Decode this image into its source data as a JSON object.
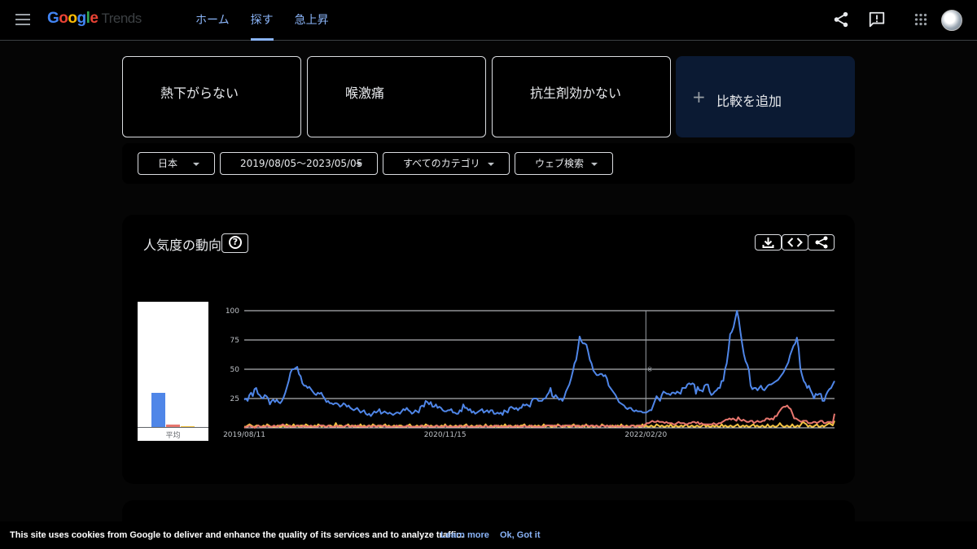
{
  "header": {
    "logo": {
      "g1": "G",
      "g2": "o",
      "g3": "o",
      "g4": "g",
      "g5": "l",
      "g6": "e",
      "product": "Trends"
    },
    "nav": [
      "ホーム",
      "探す",
      "急上昇"
    ],
    "active_nav": "探す",
    "icons": [
      "menu-icon",
      "share-icon",
      "feedback-icon",
      "apps-icon",
      "avatar"
    ]
  },
  "terms": [
    {
      "label": "熱下がらない",
      "color": "#4285f4"
    },
    {
      "label": "喉激痛",
      "color": "#ea4335"
    },
    {
      "label": "抗生剤効かない",
      "color": "#fbbc04"
    }
  ],
  "add_compare": {
    "icon": "+",
    "label": "比較を追加"
  },
  "filters": {
    "region": "日本",
    "date_range": "2019/08/05～2023/05/05",
    "category": "すべてのカテゴリ",
    "search_type": "ウェブ検索"
  },
  "interest_panel": {
    "title": "人気度の動向",
    "help_icon": "?",
    "tools": [
      "download-icon",
      "embed-icon",
      "share-icon"
    ],
    "average_label": "平均",
    "annotation_mark": "※"
  },
  "chart_data": {
    "type": "line",
    "x_tick_labels": [
      "2019/08/11",
      "2020/11/15",
      "2022/02/20"
    ],
    "y_ticks": [
      25,
      50,
      75,
      100
    ],
    "ylim": [
      0,
      100
    ],
    "grid": true,
    "x_start": "2019/08/11",
    "x_end": "2023/04/30",
    "annotation_x": "2022/02/20",
    "averages": [
      {
        "name": "熱下がらない",
        "value": 29
      },
      {
        "name": "喉激痛",
        "value": 2
      },
      {
        "name": "抗生剤効かない",
        "value": 1
      }
    ],
    "series": [
      {
        "name": "熱下がらない",
        "color": "#4f86e8",
        "values": [
          24,
          25,
          23,
          28,
          30,
          27,
          33,
          34,
          29,
          28,
          26,
          25,
          28,
          27,
          25,
          20,
          23,
          24,
          22,
          24,
          22,
          21,
          23,
          26,
          30,
          35,
          40,
          47,
          50,
          50,
          51,
          52,
          46,
          44,
          38,
          36,
          36,
          34,
          35,
          33,
          31,
          29,
          28,
          30,
          29,
          30,
          27,
          25,
          22,
          23,
          21,
          21,
          20,
          21,
          21,
          20,
          18,
          19,
          21,
          20,
          18,
          19,
          17,
          16,
          15,
          16,
          17,
          15,
          13,
          14,
          15,
          12,
          11,
          12,
          10,
          12,
          14,
          13,
          14,
          16,
          12,
          13,
          14,
          13,
          12,
          13,
          12,
          11,
          12,
          13,
          13,
          12,
          14,
          16,
          15,
          17,
          15,
          14,
          12,
          13,
          15,
          14,
          13,
          18,
          19,
          18,
          23,
          22,
          20,
          22,
          18,
          18,
          20,
          17,
          18,
          17,
          15,
          14,
          14,
          15,
          15,
          16,
          13,
          13,
          12,
          12,
          15,
          14,
          20,
          17,
          17,
          15,
          16,
          13,
          14,
          12,
          13,
          14,
          15,
          16,
          13,
          14,
          15,
          13,
          15,
          15,
          12,
          12,
          13,
          12,
          13,
          11,
          15,
          14,
          13,
          17,
          18,
          17,
          16,
          17,
          15,
          17,
          17,
          20,
          19,
          20,
          19,
          18,
          23,
          25,
          25,
          25,
          23,
          23,
          23,
          25,
          25,
          28,
          30,
          34,
          27,
          26,
          28,
          26,
          24,
          25,
          23,
          26,
          31,
          34,
          37,
          42,
          48,
          55,
          58,
          67,
          78,
          74,
          72,
          72,
          71,
          65,
          58,
          55,
          49,
          47,
          45,
          45,
          46,
          46,
          44,
          45,
          42,
          36,
          34,
          32,
          30,
          28,
          25,
          22,
          21,
          20,
          19,
          17,
          16,
          17,
          17,
          15,
          14,
          15,
          14,
          14,
          14,
          13,
          13,
          13,
          14,
          15,
          15,
          19,
          23,
          27,
          25,
          23,
          28,
          31,
          30,
          29,
          29,
          28,
          30,
          30,
          29,
          31,
          30,
          29,
          34,
          34,
          34,
          37,
          38,
          37,
          38,
          37,
          29,
          35,
          32,
          32,
          31,
          36,
          37,
          37,
          31,
          28,
          29,
          31,
          32,
          34,
          34,
          40,
          40,
          50,
          55,
          66,
          80,
          82,
          86,
          93,
          100,
          93,
          82,
          72,
          63,
          57,
          54,
          49,
          36,
          33,
          34,
          34,
          32,
          34,
          36,
          33,
          32,
          34,
          36,
          37,
          37,
          38,
          39,
          40,
          41,
          43,
          45,
          47,
          50,
          53,
          56,
          62,
          66,
          70,
          72,
          77,
          68,
          51,
          45,
          40,
          38,
          34,
          36,
          32,
          29,
          25,
          29,
          28,
          29,
          29,
          23,
          23,
          28,
          31,
          33,
          34,
          37,
          40
        ]
      },
      {
        "name": "喉激痛",
        "color": "#e8776f",
        "values": [
          0,
          1,
          1,
          2,
          1,
          1,
          0,
          1,
          2,
          1,
          1,
          1,
          1,
          2,
          1,
          1,
          1,
          2,
          1,
          1,
          2,
          2,
          3,
          2,
          1,
          1,
          2,
          1,
          1,
          1,
          2,
          2,
          1,
          1,
          2,
          1,
          1,
          1,
          2,
          1,
          1,
          1,
          1,
          2,
          2,
          2,
          1,
          1,
          2,
          1,
          1,
          1,
          1,
          2,
          1,
          1,
          1,
          1,
          2,
          2,
          1,
          1,
          2,
          1,
          1,
          2,
          1,
          1,
          1,
          1,
          1,
          2,
          1,
          1,
          2,
          1,
          1,
          2,
          2,
          1,
          2,
          1,
          1,
          1,
          1,
          1,
          1,
          2,
          1,
          1,
          1,
          1,
          1,
          2,
          1,
          1,
          1,
          1,
          1,
          1,
          1,
          2,
          1,
          1,
          1,
          2,
          1,
          1,
          1,
          1,
          2,
          1,
          1,
          1,
          1,
          2,
          1,
          1,
          1,
          1,
          1,
          1,
          1,
          2,
          1,
          1,
          1,
          2,
          1,
          1,
          1,
          1,
          1,
          1,
          2,
          1,
          1,
          1,
          2,
          1,
          1,
          1,
          1,
          2,
          1,
          2,
          1,
          1,
          1,
          1,
          1,
          2,
          1,
          1,
          1,
          1,
          2,
          1,
          1,
          1,
          2,
          1,
          1,
          1,
          2,
          1,
          1,
          1,
          1,
          1,
          1,
          1,
          2,
          2,
          2,
          2,
          2,
          1,
          2,
          2,
          2,
          1,
          2,
          1,
          2,
          2,
          2,
          1,
          2,
          2,
          1,
          2,
          1,
          1,
          2,
          2,
          2,
          1,
          2,
          2,
          1,
          2,
          1,
          1,
          2,
          2,
          1,
          2,
          1,
          2,
          1,
          1,
          2,
          1,
          1,
          1,
          2,
          1,
          1,
          1,
          1,
          2,
          2,
          1,
          1,
          2,
          2,
          1,
          2,
          3,
          4,
          4,
          5,
          6,
          5,
          5,
          6,
          5,
          5,
          5,
          4,
          5,
          4,
          4,
          4,
          3,
          3,
          4,
          5,
          4,
          4,
          4,
          3,
          3,
          4,
          4,
          5,
          5,
          4,
          5,
          3,
          4,
          3,
          3,
          3,
          3,
          3,
          3,
          4,
          3,
          3,
          4,
          4,
          5,
          6,
          7,
          7,
          8,
          7,
          8,
          7,
          6,
          9,
          7,
          6,
          7,
          6,
          5,
          5,
          6,
          6,
          4,
          5,
          6,
          5,
          5,
          6,
          6,
          8,
          8,
          7,
          8,
          7,
          10,
          10,
          13,
          15,
          17,
          18,
          18,
          19,
          17,
          16,
          12,
          8,
          8,
          7,
          6,
          5,
          6,
          6,
          6,
          4,
          4,
          4,
          5,
          5,
          4,
          5,
          6,
          6,
          4,
          4,
          5,
          5,
          5,
          4,
          12
        ]
      },
      {
        "name": "抗生剤効かない",
        "color": "#f4c542",
        "values": [
          1,
          1,
          2,
          3,
          2,
          1,
          1,
          2,
          2,
          1,
          1,
          2,
          1,
          3,
          2,
          1,
          1,
          1,
          1,
          2,
          1,
          1,
          2,
          1,
          3,
          2,
          1,
          1,
          3,
          1,
          2,
          1,
          2,
          2,
          1,
          3,
          2,
          1,
          1,
          1,
          2,
          1,
          3,
          2,
          1,
          2,
          1,
          1,
          2,
          2,
          1,
          1,
          4,
          1,
          2,
          2,
          1,
          1,
          2,
          3,
          1,
          2,
          1,
          2,
          1,
          1,
          3,
          1,
          2,
          1,
          1,
          2,
          1,
          3,
          2,
          1,
          2,
          1,
          1,
          2,
          3,
          1,
          2,
          1,
          1,
          2,
          1,
          1,
          2,
          2,
          1,
          1,
          1,
          2,
          3,
          1,
          1,
          1,
          2,
          1,
          1,
          2,
          1,
          3,
          2,
          1,
          2,
          1,
          1,
          2,
          1,
          1,
          2,
          1,
          3,
          1,
          1,
          2,
          1,
          1,
          2,
          1,
          1,
          2,
          1,
          2,
          3,
          1,
          1,
          2,
          1,
          1,
          2,
          1,
          2,
          1,
          1,
          3,
          1,
          1,
          2,
          1,
          1,
          2,
          1,
          1,
          2,
          1,
          3,
          1,
          1,
          2,
          1,
          1,
          2,
          1,
          1,
          2,
          2,
          3,
          1,
          1,
          2,
          1,
          1,
          2,
          1,
          2,
          1,
          1,
          3,
          1,
          2,
          2,
          1,
          1,
          2,
          1,
          3,
          2,
          1,
          1,
          2,
          2,
          1,
          1,
          2,
          3,
          1,
          2,
          1,
          1,
          2,
          1,
          3,
          1,
          1,
          2,
          1,
          1,
          2,
          1,
          1,
          3,
          2,
          1,
          2,
          1,
          1,
          2,
          1,
          1,
          2,
          1,
          3,
          1,
          1,
          2,
          1,
          1,
          2,
          2,
          1,
          2,
          1,
          1,
          3,
          1,
          2,
          1,
          1,
          2,
          1,
          1,
          3,
          2,
          1,
          2,
          1,
          1,
          2,
          1,
          3,
          1,
          1,
          2,
          1,
          1,
          2,
          1,
          2,
          3,
          1,
          1,
          2,
          1,
          1,
          2,
          1,
          1,
          2,
          3,
          1,
          2,
          1,
          1,
          2,
          1,
          2,
          1,
          1,
          3,
          1,
          2,
          1,
          1,
          2,
          1,
          1,
          2,
          3,
          1,
          1,
          2,
          1,
          2,
          1,
          1,
          2,
          3,
          1,
          2,
          1,
          1,
          2,
          1,
          1,
          3,
          1,
          1,
          2,
          1,
          1,
          2,
          4,
          2,
          1,
          1,
          2,
          1,
          1,
          3,
          1,
          1,
          2,
          1,
          3,
          5,
          4,
          3,
          1,
          2,
          1,
          1,
          2,
          3,
          1,
          1,
          2,
          1,
          2,
          3,
          4,
          3,
          2,
          6
        ]
      }
    ]
  },
  "cookie_bar": {
    "text": "This site uses cookies from Google to deliver and enhance the quality of its services and to analyze traffic.",
    "learn_more": "Learn more",
    "ok": "Ok, Got it"
  }
}
